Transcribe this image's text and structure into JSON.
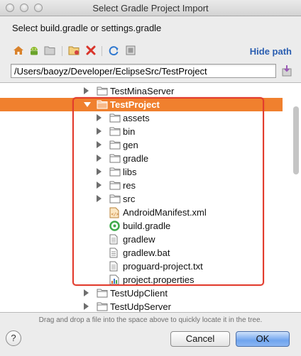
{
  "window": {
    "title": "Select Gradle Project Import"
  },
  "prompt": "Select build.gradle or settings.gradle",
  "toolbar": {
    "icons": [
      "home-icon",
      "android-icon",
      "project-folder-icon",
      "new-folder-icon",
      "delete-icon",
      "refresh-icon",
      "show-hidden-icon"
    ],
    "hide_path_label": "Hide path"
  },
  "path": {
    "value": "/Users/baoyz/Developer/EclipseSrc/TestProject"
  },
  "tree": {
    "items": [
      {
        "label": "TestMinaServer",
        "kind": "folder",
        "expand": "collapsed"
      },
      {
        "label": "TestProject",
        "kind": "folder",
        "expand": "expanded",
        "selected": true
      },
      {
        "label": "assets",
        "kind": "folder",
        "expand": "collapsed"
      },
      {
        "label": "bin",
        "kind": "folder",
        "expand": "collapsed"
      },
      {
        "label": "gen",
        "kind": "folder",
        "expand": "collapsed"
      },
      {
        "label": "gradle",
        "kind": "folder",
        "expand": "collapsed"
      },
      {
        "label": "libs",
        "kind": "folder",
        "expand": "collapsed"
      },
      {
        "label": "res",
        "kind": "folder",
        "expand": "collapsed"
      },
      {
        "label": "src",
        "kind": "folder",
        "expand": "collapsed"
      },
      {
        "label": "AndroidManifest.xml",
        "kind": "xml"
      },
      {
        "label": "build.gradle",
        "kind": "gradle"
      },
      {
        "label": "gradlew",
        "kind": "file"
      },
      {
        "label": "gradlew.bat",
        "kind": "file"
      },
      {
        "label": "proguard-project.txt",
        "kind": "file"
      },
      {
        "label": "project.properties",
        "kind": "properties"
      },
      {
        "label": "TestUdpClient",
        "kind": "folder",
        "expand": "collapsed"
      },
      {
        "label": "TestUdpServer",
        "kind": "folder",
        "expand": "collapsed"
      }
    ]
  },
  "hint": "Drag and drop a file into the space above to quickly locate it in the tree.",
  "buttons": {
    "help": "?",
    "cancel": "Cancel",
    "ok": "OK"
  },
  "colors": {
    "selection": "#f0802e",
    "highlight_box": "#e23b2d",
    "link": "#2a5db0"
  }
}
